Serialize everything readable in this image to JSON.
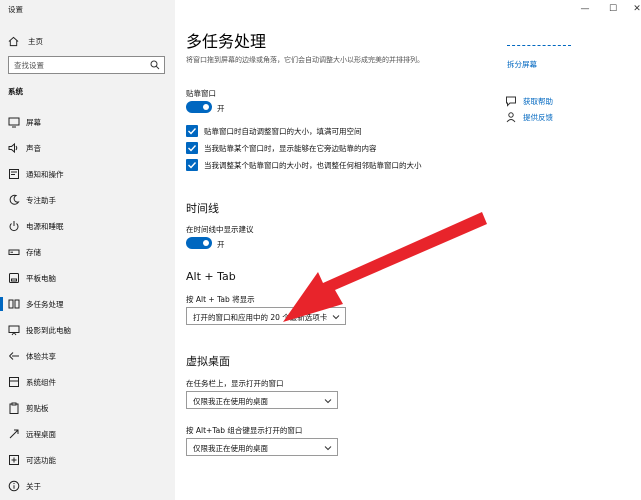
{
  "window": {
    "title": "设置",
    "minimize_glyph": "—",
    "maximize_glyph": "☐",
    "close_glyph": "✕"
  },
  "sidebar": {
    "home_label": "主页",
    "search_placeholder": "查找设置",
    "section_label": "系统",
    "items": [
      {
        "label": "屏幕",
        "icon": "monitor-icon"
      },
      {
        "label": "声音",
        "icon": "speaker-icon"
      },
      {
        "label": "通知和操作",
        "icon": "notification-icon"
      },
      {
        "label": "专注助手",
        "icon": "moon-icon"
      },
      {
        "label": "电源和睡眠",
        "icon": "power-icon"
      },
      {
        "label": "存储",
        "icon": "storage-icon"
      },
      {
        "label": "平板电脑",
        "icon": "tablet-icon"
      },
      {
        "label": "多任务处理",
        "icon": "multitasking-icon",
        "selected": true
      },
      {
        "label": "投影到此电脑",
        "icon": "project-icon"
      },
      {
        "label": "体验共享",
        "icon": "share-icon"
      },
      {
        "label": "系统组件",
        "icon": "components-icon"
      },
      {
        "label": "剪贴板",
        "icon": "clipboard-icon"
      },
      {
        "label": "远程桌面",
        "icon": "remote-icon"
      },
      {
        "label": "可选功能",
        "icon": "optional-features-icon"
      },
      {
        "label": "关于",
        "icon": "info-icon"
      }
    ]
  },
  "main": {
    "title": "多任务处理",
    "description": "将窗口拖到屏幕的边缘或角落，它们会自动调整大小以形成完美的并排排列。",
    "snap": {
      "heading": "贴靠窗口",
      "toggle_state": "开",
      "options": [
        "贴靠窗口时自动调整窗口的大小，填满可用空间",
        "当我贴靠某个窗口时，显示能够在它旁边贴靠的内容",
        "当我调整某个贴靠窗口的大小时，也调整任何相邻贴靠窗口的大小"
      ]
    },
    "timeline": {
      "heading": "时间线",
      "label": "在时间线中显示建议",
      "toggle_state": "开"
    },
    "alt_tab": {
      "heading": "Alt + Tab",
      "label": "按 Alt + Tab 将显示",
      "value": "打开的窗口和应用中的 20 个最新选项卡"
    },
    "virtual_desktops": {
      "heading": "虚拟桌面",
      "taskbar_label": "在任务栏上，显示打开的窗口",
      "taskbar_value": "仅限我正在使用的桌面",
      "alttab_label": "按 Alt+Tab 组合键显示打开的窗口",
      "alttab_value": "仅限我正在使用的桌面"
    }
  },
  "right_panel": {
    "link_top": "拆分屏幕",
    "help": "获取帮助",
    "feedback": "提供反馈"
  },
  "colors": {
    "accent": "#0067c0",
    "sidebar_bg": "#f2f2f2",
    "arrow": "#e8242b"
  }
}
